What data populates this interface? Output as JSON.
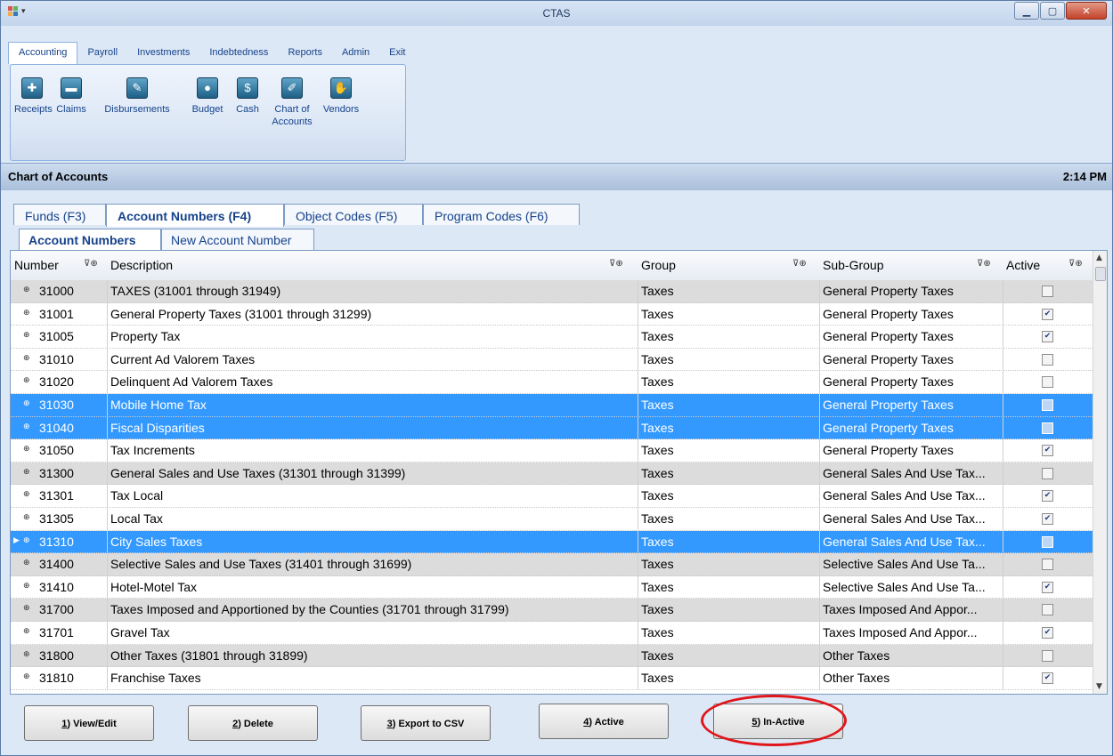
{
  "window": {
    "title": "CTAS"
  },
  "menu": {
    "items": [
      "Accounting",
      "Payroll",
      "Investments",
      "Indebtedness",
      "Reports",
      "Admin",
      "Exit"
    ],
    "active": "Accounting"
  },
  "ribbon": {
    "buttons": [
      {
        "label": "Receipts",
        "icon": "receipts-icon"
      },
      {
        "label": "Claims",
        "icon": "claims-icon"
      },
      {
        "label": "Disbursements",
        "icon": "disbursements-icon"
      },
      {
        "label": "Budget",
        "icon": "budget-icon"
      },
      {
        "label": "Cash",
        "icon": "cash-icon"
      },
      {
        "label": "Chart of Accounts",
        "icon": "chart-of-accounts-icon"
      },
      {
        "label": "Vendors",
        "icon": "vendors-icon"
      }
    ]
  },
  "header": {
    "title": "Chart of Accounts",
    "time": "2:14 PM"
  },
  "tabs": [
    "Funds (F3)",
    "Account Numbers (F4)",
    "Object Codes (F5)",
    "Program Codes (F6)"
  ],
  "subtabs": [
    "Account Numbers",
    "New Account Number"
  ],
  "grid": {
    "columns": [
      "Number",
      "Description",
      "Group",
      "Sub-Group",
      "Active"
    ],
    "rows": [
      {
        "number": "31000",
        "description": "TAXES (31001 through 31949)",
        "group": "Taxes",
        "subgroup": "General Property Taxes",
        "active": false,
        "type": "group"
      },
      {
        "number": "31001",
        "description": "General Property Taxes (31001 through 31299)",
        "group": "Taxes",
        "subgroup": "General Property Taxes",
        "active": true,
        "type": "normal"
      },
      {
        "number": "31005",
        "description": "Property Tax",
        "group": "Taxes",
        "subgroup": "General Property Taxes",
        "active": true,
        "type": "normal"
      },
      {
        "number": "31010",
        "description": "Current Ad Valorem Taxes",
        "group": "Taxes",
        "subgroup": "General Property Taxes",
        "active": false,
        "type": "normal"
      },
      {
        "number": "31020",
        "description": "Delinquent Ad Valorem Taxes",
        "group": "Taxes",
        "subgroup": "General Property Taxes",
        "active": false,
        "type": "normal"
      },
      {
        "number": "31030",
        "description": "Mobile Home Tax",
        "group": "Taxes",
        "subgroup": "General Property Taxes",
        "active": false,
        "type": "selected"
      },
      {
        "number": "31040",
        "description": "Fiscal Disparities",
        "group": "Taxes",
        "subgroup": "General Property Taxes",
        "active": false,
        "type": "selected"
      },
      {
        "number": "31050",
        "description": "Tax Increments",
        "group": "Taxes",
        "subgroup": "General Property Taxes",
        "active": true,
        "type": "normal"
      },
      {
        "number": "31300",
        "description": "General Sales and Use Taxes (31301 through 31399)",
        "group": "Taxes",
        "subgroup": "General Sales And Use Tax...",
        "active": false,
        "type": "group"
      },
      {
        "number": "31301",
        "description": "Tax Local",
        "group": "Taxes",
        "subgroup": "General Sales And Use Tax...",
        "active": true,
        "type": "normal"
      },
      {
        "number": "31305",
        "description": "Local Tax",
        "group": "Taxes",
        "subgroup": "General Sales And Use Tax...",
        "active": true,
        "type": "normal"
      },
      {
        "number": "31310",
        "description": "City Sales Taxes",
        "group": "Taxes",
        "subgroup": "General Sales And Use Tax...",
        "active": false,
        "type": "selected",
        "current": true
      },
      {
        "number": "31400",
        "description": "Selective Sales and Use Taxes (31401 through 31699)",
        "group": "Taxes",
        "subgroup": "Selective Sales And Use Ta...",
        "active": false,
        "type": "group"
      },
      {
        "number": "31410",
        "description": "Hotel-Motel Tax",
        "group": "Taxes",
        "subgroup": "Selective Sales And Use Ta...",
        "active": true,
        "type": "normal"
      },
      {
        "number": "31700",
        "description": "Taxes Imposed and Apportioned by the Counties (31701 through 31799)",
        "group": "Taxes",
        "subgroup": "Taxes Imposed And Appor...",
        "active": false,
        "type": "group"
      },
      {
        "number": "31701",
        "description": "Gravel Tax",
        "group": "Taxes",
        "subgroup": "Taxes Imposed And Appor...",
        "active": true,
        "type": "normal"
      },
      {
        "number": "31800",
        "description": "Other Taxes (31801 through 31899)",
        "group": "Taxes",
        "subgroup": "Other Taxes",
        "active": false,
        "type": "group"
      },
      {
        "number": "31810",
        "description": "Franchise Taxes",
        "group": "Taxes",
        "subgroup": "Other Taxes",
        "active": true,
        "type": "normal"
      }
    ]
  },
  "buttons": [
    {
      "key": "1",
      "label": ") View/Edit"
    },
    {
      "key": "2",
      "label": ") Delete"
    },
    {
      "key": "3",
      "label": ") Export to CSV"
    },
    {
      "key": "4",
      "label": ") Active"
    },
    {
      "key": "5",
      "label": ") In-Active"
    }
  ],
  "colors": {
    "selection": "#3399ff",
    "group_row": "#dcdcdc",
    "highlight_circle": "#e0161b"
  }
}
